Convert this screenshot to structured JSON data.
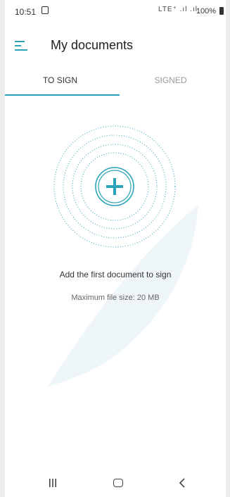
{
  "status_bar": {
    "time": "10:51",
    "network_icons": "LTE⁺ .ıl .ıl",
    "battery": "100%"
  },
  "app_bar": {
    "title": "My documents",
    "menu_icon": "menu-icon"
  },
  "tabs": [
    {
      "label": "TO SIGN",
      "active": true
    },
    {
      "label": "SIGNED",
      "active": false
    }
  ],
  "main": {
    "add_button_icon": "plus-icon",
    "message": "Add the first document to sign",
    "submessage": "Maximum file size: 20 MB"
  },
  "nav_bar": {
    "recent_icon": "recent-apps-icon",
    "home_icon": "home-icon",
    "back_icon": "back-icon"
  },
  "colors": {
    "accent": "#2aa3b8",
    "watermark": "#eef6fa"
  }
}
